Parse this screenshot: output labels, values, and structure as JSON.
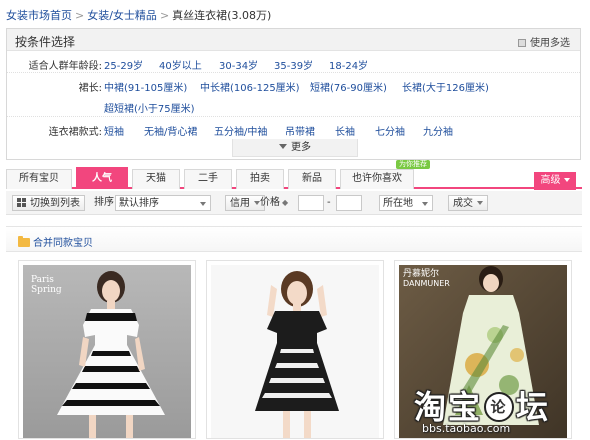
{
  "breadcrumb": {
    "home": "女装市场首页",
    "sep": ">",
    "category": "女装/女士精品",
    "current": "真丝连衣裙",
    "count": "(3.08万)"
  },
  "filter": {
    "title": "按条件选择",
    "multi_select": "使用多选",
    "rows": [
      {
        "label": "适合人群年龄段:",
        "options": [
          "25-29岁",
          "40岁以上",
          "30-34岁",
          "35-39岁",
          "18-24岁"
        ]
      },
      {
        "label": "裙长:",
        "options": [
          "中裙(91-105厘米)",
          "中长裙(106-125厘米)",
          "短裙(76-90厘米)",
          "长裙(大于126厘米)",
          "超短裙(小于75厘米)"
        ]
      },
      {
        "label": "连衣裙款式:",
        "options": [
          "短袖",
          "无袖/背心裙",
          "五分袖/中袖",
          "吊带裙",
          "长袖",
          "七分袖",
          "九分袖"
        ]
      }
    ],
    "more": "更多"
  },
  "tabs": [
    "所有宝贝",
    "人气",
    "天猫",
    "二手",
    "拍卖",
    "新品",
    "也许你喜欢"
  ],
  "active_tab": "人气",
  "new_badge": "为你推荐",
  "sort_button": "高级",
  "toolbar": {
    "switch_list": "切换到列表",
    "sort_label": "排序",
    "sort_value": "默认排序",
    "credit": "信用",
    "price": "价格",
    "price_dash": "-",
    "location": "所在地",
    "deals": "成交"
  },
  "merge_label": "合并同款宝贝",
  "products": [
    {
      "brand_line1": "Paris",
      "brand_line2": "Spring"
    },
    {
      "brand_line1": "",
      "brand_line2": ""
    },
    {
      "brand_line1": "丹慕妮尔",
      "brand_line2": "DANMUNER"
    }
  ],
  "watermark": {
    "char1": "淘",
    "char2": "宝",
    "char3": "论",
    "char4": "坛",
    "url": "bbs.taobao.com"
  },
  "colors": {
    "accent": "#f2467e",
    "link": "#1f4e9c"
  }
}
